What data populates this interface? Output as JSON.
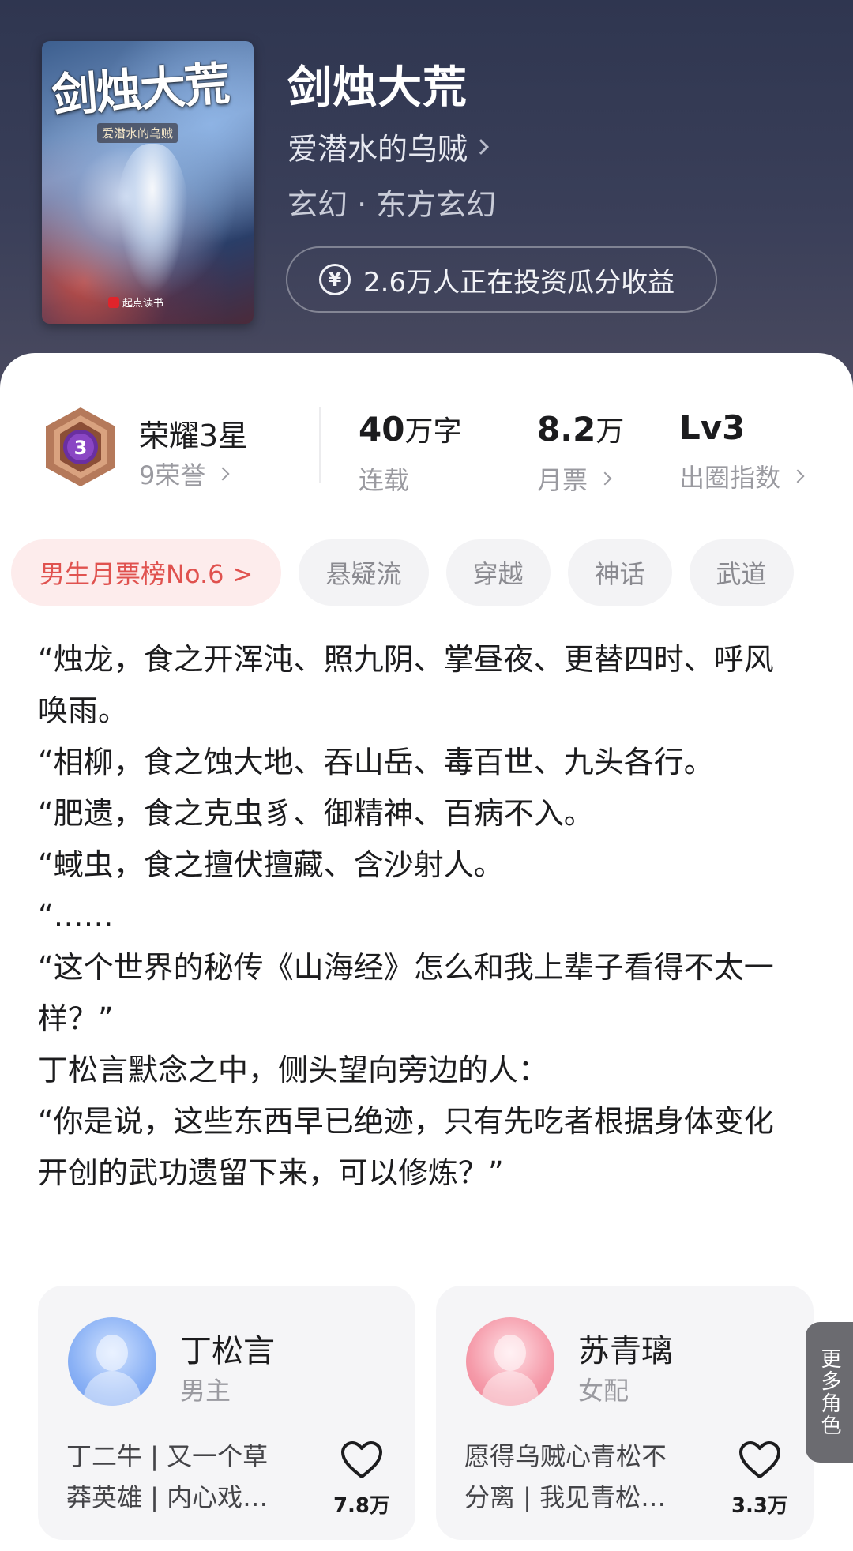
{
  "book": {
    "cover_title": "剑烛大荒",
    "cover_subtitle": "爱潜水的乌贼",
    "cover_publisher": "起点读书",
    "title": "剑烛大荒",
    "author": "爱潜水的乌贼",
    "genre": "玄幻 · 东方玄幻",
    "invest_text": "2.6万人正在投资瓜分收益",
    "invest_icon": "yen-circle-icon"
  },
  "stats": {
    "honor_level": "荣耀3星",
    "honor_badge_number": "3",
    "honor_count": "9荣誉",
    "word_count_value": "40",
    "word_count_unit": "万字",
    "word_count_label": "连载",
    "monthly_ticket_value": "8.2",
    "monthly_ticket_unit": "万",
    "monthly_ticket_label": "月票",
    "circle_value": "Lv3",
    "circle_label": "出圈指数"
  },
  "tags": [
    "男生月票榜No.6 >",
    "悬疑流",
    "穿越",
    "神话",
    "武道"
  ],
  "synopsis": [
    "“烛龙，食之开浑沌、照九阴、掌昼夜、更替四时、呼风唤雨。",
    "“相柳，食之蚀大地、吞山岳、毒百世、九头各行。",
    "“肥遗，食之克虫豸、御精神、百病不入。",
    "“蜮虫，食之擅伏擅藏、含沙射人。",
    "“……",
    "“这个世界的秘传《山海经》怎么和我上辈子看得不太一样？”",
    "丁松言默念之中，侧头望向旁边的人：",
    "“你是说，这些东西早已绝迹，只有先吃者根据身体变化开创的武功遗留下来，可以修炼？”"
  ],
  "characters": [
    {
      "name": "丁松言",
      "role": "男主",
      "desc_line1": "丁二牛 | 又一个草",
      "desc_line2": "莽英雄 | 内心戏…",
      "likes": "7.8万"
    },
    {
      "name": "苏青璃",
      "role": "女配",
      "desc_line1": "愿得乌贼心青松不",
      "desc_line2": "分离 | 我见青松…",
      "likes": "3.3万"
    }
  ],
  "more_roles": "更多角色",
  "colors": {
    "header_bg": "#363c56",
    "rank_tag_bg": "#fdecec",
    "rank_tag_text": "#e0524f",
    "badge_purple": "#6a2fa0",
    "badge_bronze": "#a86a4a"
  }
}
